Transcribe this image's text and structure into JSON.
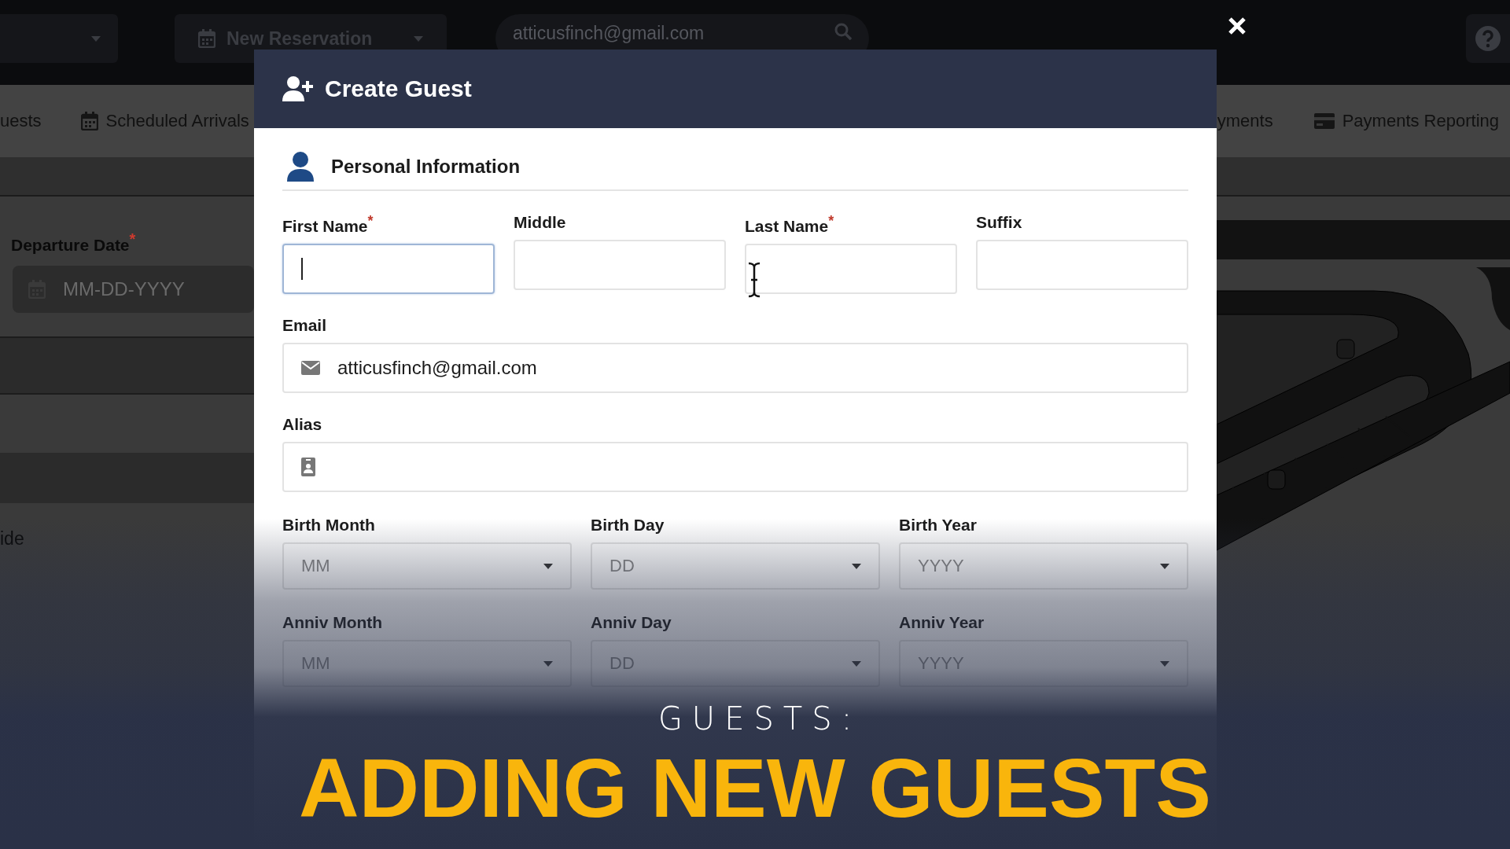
{
  "background_app": {
    "top_bar": {
      "reservation_button": "New Reservation",
      "search_value": "atticusfinch@gmail.com"
    },
    "nav_items": [
      {
        "label": "uests",
        "kind": "none"
      },
      {
        "label": "Scheduled Arrivals",
        "kind": "calendar"
      },
      {
        "label": "yments",
        "kind": "none"
      },
      {
        "label": "Payments Reporting",
        "kind": "card"
      }
    ],
    "departure": {
      "label": "Departure Date",
      "required_mark": "*",
      "placeholder": "MM-DD-YYYY"
    },
    "fragment": "ide"
  },
  "modal": {
    "title": "Create Guest",
    "section": "Personal Information",
    "name_fields": [
      {
        "label": "First Name",
        "required_mark": "*",
        "focused": true
      },
      {
        "label": "Middle",
        "focused": false
      },
      {
        "label": "Last Name",
        "required_mark": "*",
        "focused": false
      },
      {
        "label": "Suffix",
        "focused": false
      }
    ],
    "email": {
      "label": "Email",
      "value": "atticusfinch@gmail.com"
    },
    "alias": {
      "label": "Alias"
    },
    "date_rows": [
      {
        "fields": [
          {
            "label": "Birth Month",
            "placeholder": "MM"
          },
          {
            "label": "Birth Day",
            "placeholder": "DD"
          },
          {
            "label": "Birth Year",
            "placeholder": "YYYY"
          }
        ]
      },
      {
        "fields": [
          {
            "label": "Anniv Month",
            "placeholder": "MM"
          },
          {
            "label": "Anniv Day",
            "placeholder": "DD"
          },
          {
            "label": "Anniv Year",
            "placeholder": "YYYY"
          }
        ]
      }
    ]
  },
  "overlay": {
    "kicker": "GUESTS:",
    "headline": "ADDING NEW GUESTS"
  }
}
